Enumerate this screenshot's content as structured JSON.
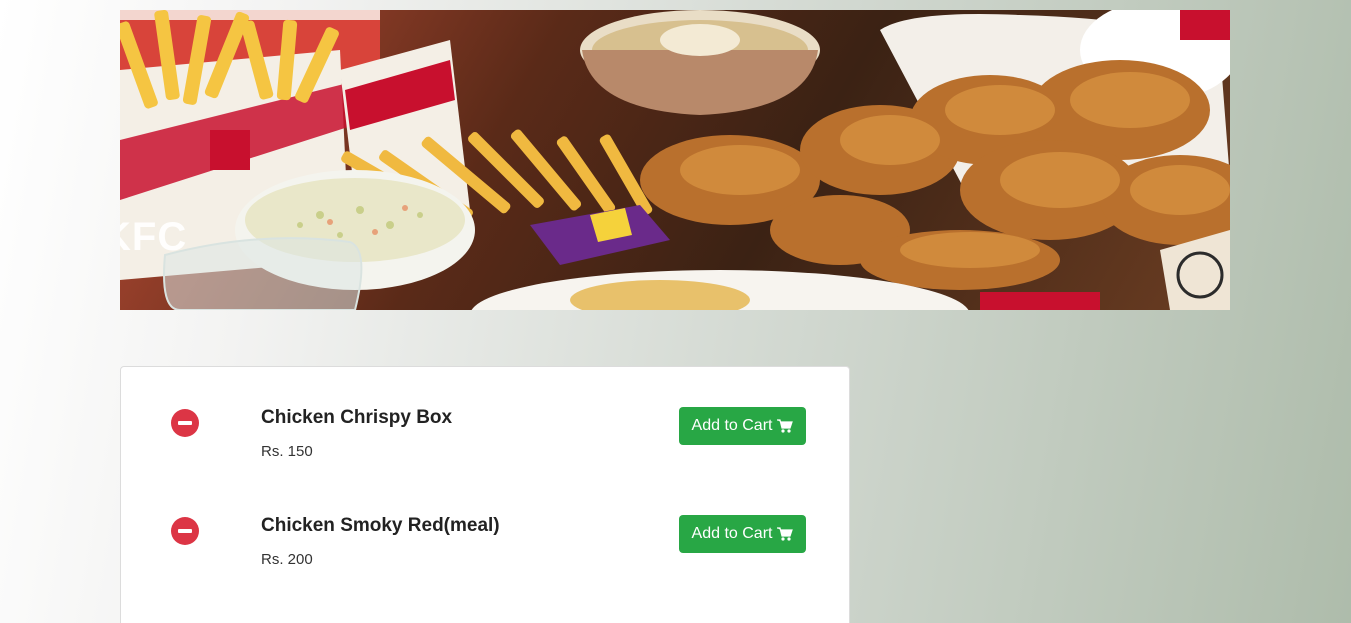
{
  "banner": {
    "overlay_text": "KFC"
  },
  "menu": {
    "items": [
      {
        "name": "Chicken Chrispy Box",
        "price": "Rs. 150",
        "button_label": "Add to Cart",
        "remove_icon": "minus-circle-icon",
        "cart_icon": "shopping-cart-icon"
      },
      {
        "name": "Chicken Smoky Red(meal)",
        "price": "Rs. 200",
        "button_label": "Add to Cart",
        "remove_icon": "minus-circle-icon",
        "cart_icon": "shopping-cart-icon"
      }
    ]
  },
  "colors": {
    "remove": "#dc3545",
    "add_to_cart": "#28a745"
  }
}
